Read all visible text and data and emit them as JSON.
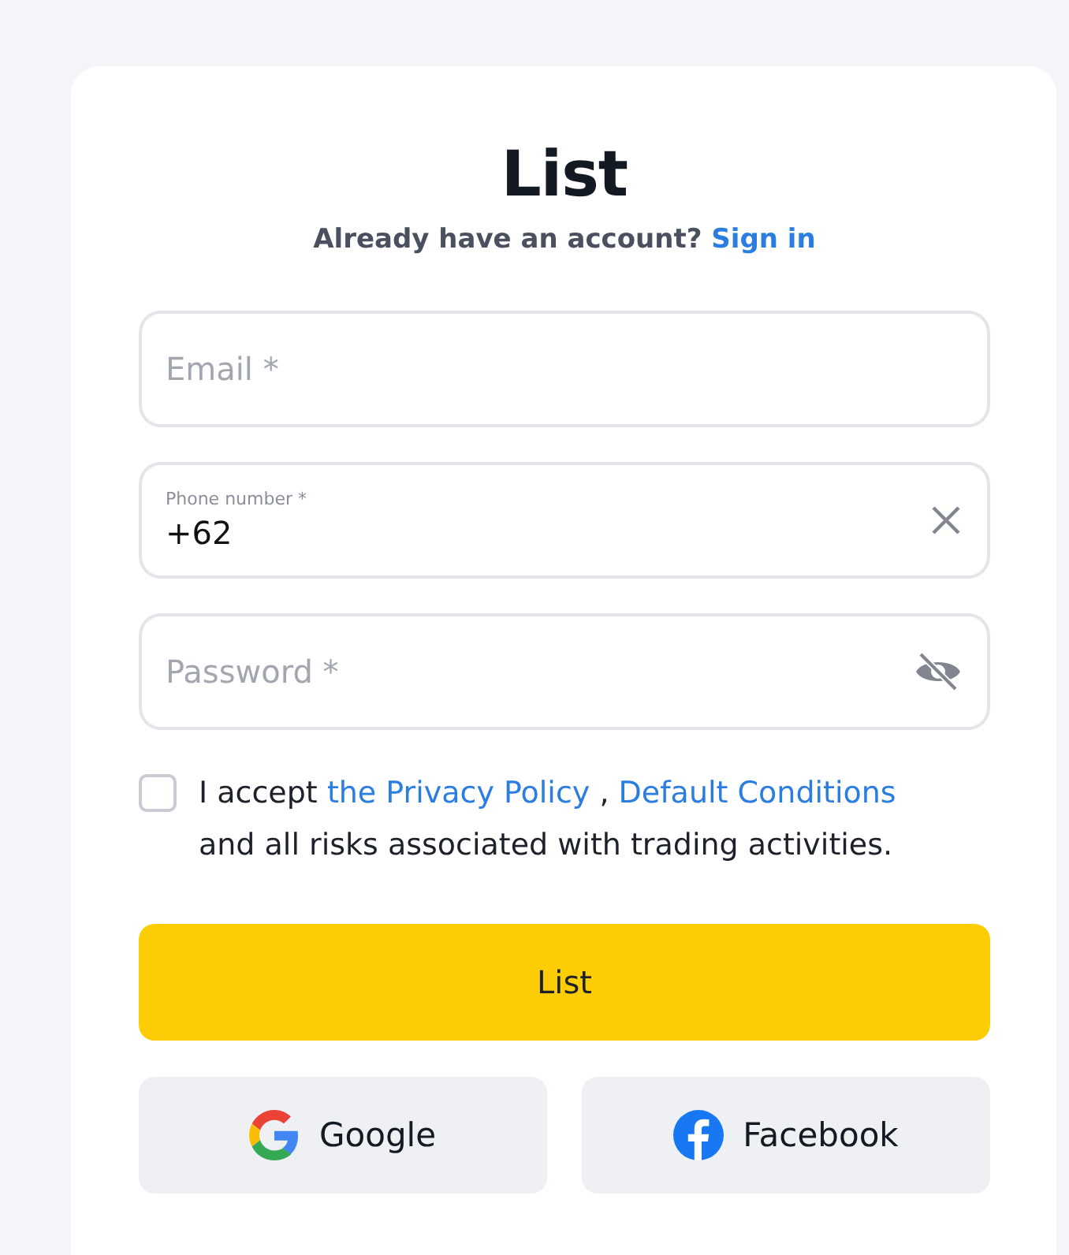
{
  "title": "List",
  "signin": {
    "prompt": "Already have an account?",
    "link": "Sign in"
  },
  "fields": [
    {
      "kind": "text",
      "placeholder": "Email *"
    },
    {
      "kind": "phone",
      "label": "Phone number *",
      "value": "+62",
      "clearable": true
    },
    {
      "kind": "password",
      "placeholder": "Password *",
      "revealed": false
    }
  ],
  "agreement": {
    "checked": false,
    "parts": [
      {
        "kind": "text",
        "text": "I accept"
      },
      {
        "kind": "link",
        "text": "the Privacy Policy"
      },
      {
        "kind": "text",
        "text": ","
      },
      {
        "kind": "link",
        "text": "Default Conditions"
      },
      {
        "kind": "text",
        "text": "and all risks associated with trading activities."
      }
    ]
  },
  "submit": "List",
  "social": [
    {
      "kind": "google",
      "label": "Google"
    },
    {
      "kind": "facebook",
      "label": "Facebook"
    }
  ]
}
